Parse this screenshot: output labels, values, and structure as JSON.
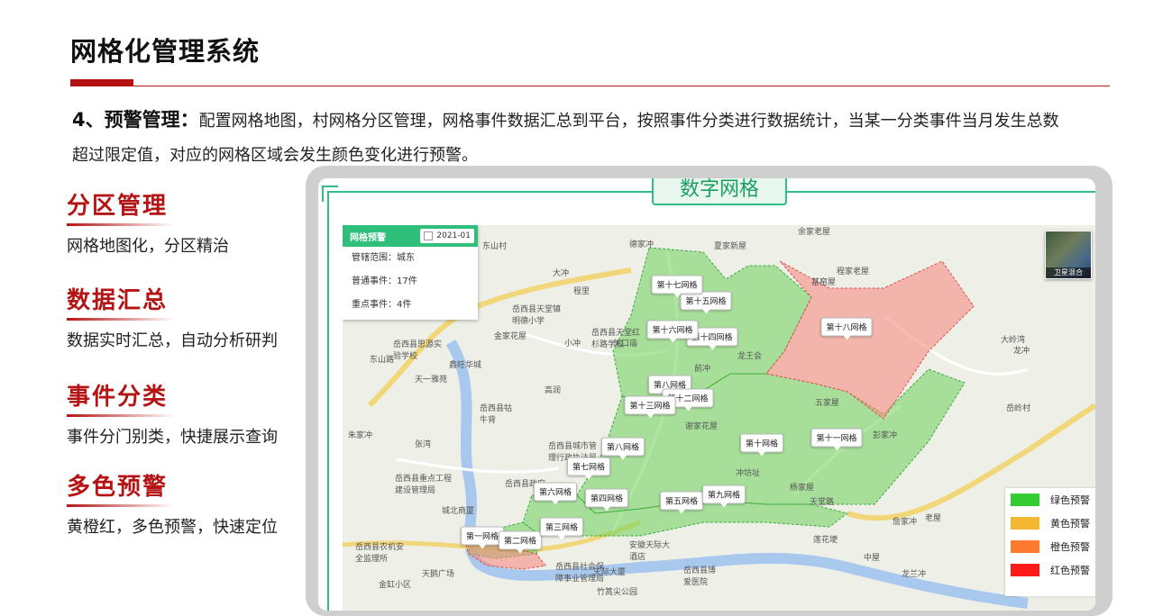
{
  "page": {
    "title": "网格化管理系统",
    "intro_lead": "4、预警管理：",
    "intro_text": "配置网格地图，村网格分区管理，网格事件数据汇总到平台，按照事件分类进行数据统计，当某一分类事件当月发生总数超过限定值，对应的网格区域会发生颜色变化进行预警。"
  },
  "features": [
    {
      "title": "分区管理",
      "desc": "网格地图化，分区精治"
    },
    {
      "title": "数据汇总",
      "desc": "数据实时汇总，自动分析研判"
    },
    {
      "title": "事件分类",
      "desc": "事件分门别类，快捷展示查询"
    },
    {
      "title": "多色预警",
      "desc": "黄橙红，多色预警，快速定位"
    }
  ],
  "screen": {
    "banner": "数字网格"
  },
  "panel": {
    "title": "网格预警",
    "date": "2021-01",
    "scope": "管辖范围：城东",
    "normal": "普通事件：17件",
    "key": "重点事件：4件"
  },
  "satellite": {
    "label": "卫星混合",
    "icon": "satellite-thumbnail-icon"
  },
  "legend": [
    {
      "label": "绿色预警",
      "color": "#33cc33"
    },
    {
      "label": "黄色预警",
      "color": "#f4b731"
    },
    {
      "label": "橙色预警",
      "color": "#ff7a2e"
    },
    {
      "label": "红色预警",
      "color": "#ff1a1a"
    }
  ],
  "grids": [
    {
      "label": "第一网格"
    },
    {
      "label": "第二网格"
    },
    {
      "label": "第三网格"
    },
    {
      "label": "第四网格"
    },
    {
      "label": "第五网格"
    },
    {
      "label": "第六网格"
    },
    {
      "label": "第七网格"
    },
    {
      "label": "第八网格"
    },
    {
      "label": "第八网格"
    },
    {
      "label": "第九网格"
    },
    {
      "label": "第十网格"
    },
    {
      "label": "第十一网格"
    },
    {
      "label": "第十二网格"
    },
    {
      "label": "第十三网格"
    },
    {
      "label": "第十四网格"
    },
    {
      "label": "第十五网格"
    },
    {
      "label": "第十六网格"
    },
    {
      "label": "第十七网格"
    },
    {
      "label": "第十八网格"
    }
  ],
  "places": [
    "德家冲",
    "夏家新屋",
    "余家老屋",
    "东山村",
    "大冲",
    "程家老屋",
    "岳西县天堂镇明德小学",
    "程里",
    "基窑屋",
    "金家花屋",
    "岳西县思源实验学校",
    "岳西县天堂红杉路学校",
    "关口庙",
    "小冲",
    "龙王会",
    "前冲",
    "鑫旺华城",
    "天一雅苑",
    "高润",
    "岳西县牯牛背",
    "岳西县城市管理行政执法局",
    "朱家冲",
    "张湾",
    "谢家花屋",
    "五家屋",
    "彭家冲",
    "岳西县重点工程建设管理局",
    "冲坊址",
    "杨家屋",
    "岳西县政府",
    "城北商厦",
    "岳西县农机安全监理所",
    "安徽天际大酒店",
    "岳西县社会保障事业管理局",
    "天际大厦",
    "竹篙尖公园",
    "岳西县博爱医院",
    "天鹅广场",
    "金缸小区",
    "大岭湾",
    "龙冲",
    "岳岭村",
    "莲花埂",
    "詹家冲",
    "老屋",
    "中屋",
    "龙兰冲",
    "东山路",
    "天堂路"
  ]
}
